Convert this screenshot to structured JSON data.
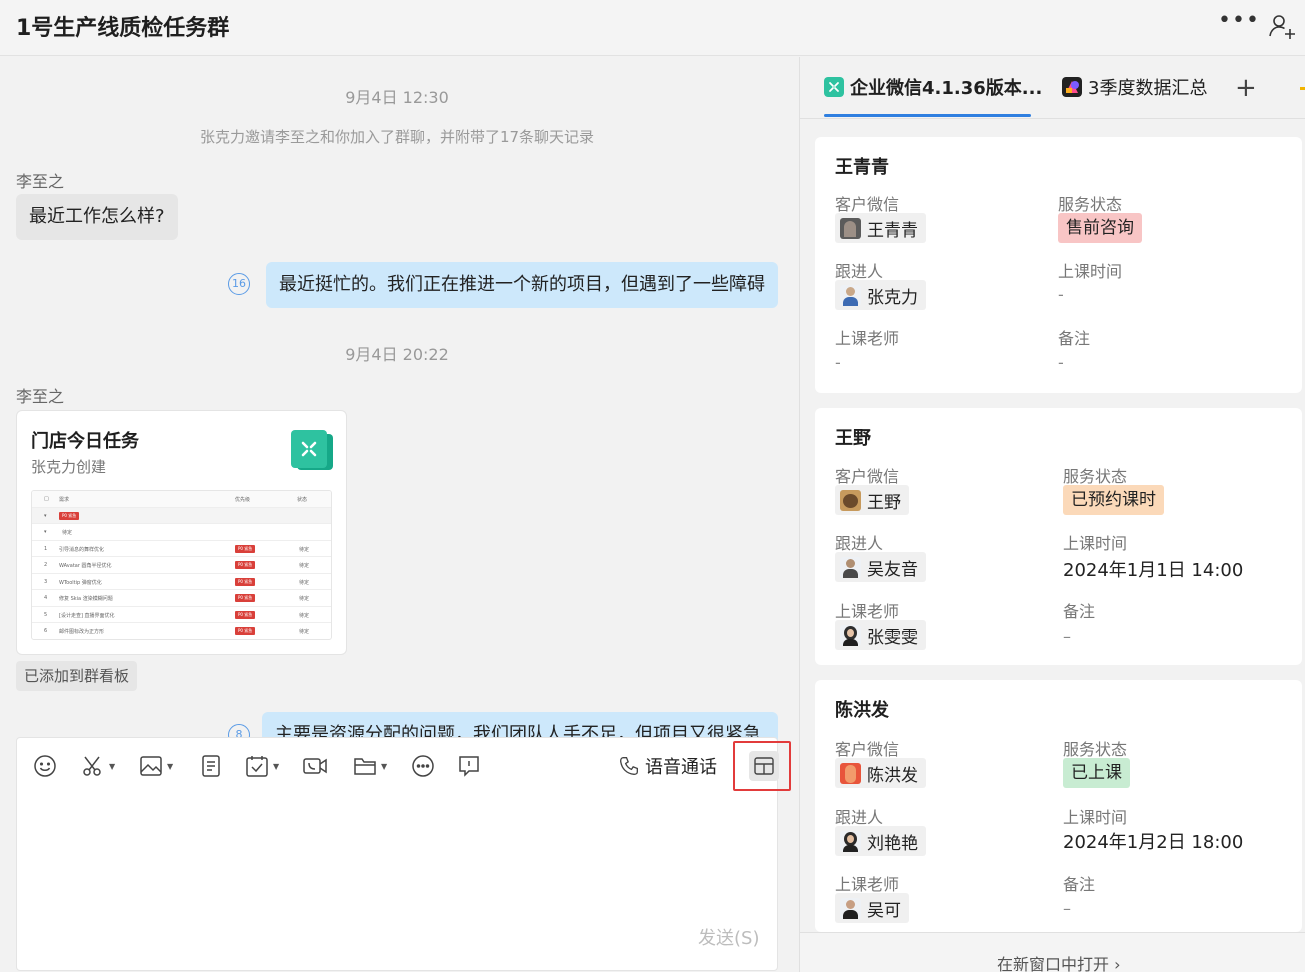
{
  "header": {
    "title": "1号生产线质检任务群"
  },
  "chat": {
    "ts1": "9月4日 12:30",
    "system_msg": "张克力邀请李至之和你加入了群聊，并附带了17条聊天记录",
    "msg1_sender": "李至之",
    "msg1_text": "最近工作怎么样?",
    "msg2_read": "16",
    "msg2_text": "最近挺忙的。我们正在推进一个新的项目，但遇到了一些障碍",
    "ts2": "9月4日 20:22",
    "msg3_sender": "李至之",
    "card": {
      "title": "门店今日任务",
      "creator": "张克力创建",
      "preview": {
        "headers": [
          "需求",
          "优先级",
          "状态"
        ],
        "group_tag": "P0 紧急",
        "group_label": "待定",
        "rows": [
          {
            "n": "1",
            "text": "引导消息的舞样优化",
            "tag": "P0 紧急",
            "status": "待定"
          },
          {
            "n": "2",
            "text": "WAvatar 圆角半径优化",
            "tag": "P0 紧急",
            "status": "待定"
          },
          {
            "n": "3",
            "text": "WTooltip 弹窗优化",
            "tag": "P0 紧急",
            "status": "待定"
          },
          {
            "n": "4",
            "text": "修复 Skia 渲染模糊问题",
            "tag": "P0 紧急",
            "status": "待定"
          },
          {
            "n": "5",
            "text": "[设计走查] 直播界面优化",
            "tag": "P0 紧急",
            "status": "待定"
          },
          {
            "n": "6",
            "text": "邮件图标改为正方形",
            "tag": "P0 紧急",
            "status": "待定"
          }
        ]
      }
    },
    "added_chip": "已添加到群看板",
    "msg4_text": "主要是资源分配的问题，我们团队人手不足，但项目又很紧急"
  },
  "composer": {
    "voice_label": "语音通话",
    "send_label": "发送(S)",
    "tools": [
      "emoji-icon",
      "scissors-icon",
      "image-icon",
      "document-icon",
      "calendar-check-icon",
      "video-icon",
      "folder-icon",
      "more-icon",
      "comment-icon"
    ]
  },
  "right": {
    "tabs": [
      {
        "label": "企业微信4.1.36版本...",
        "active": true
      },
      {
        "label": "3季度数据汇总",
        "active": false
      }
    ],
    "labels": {
      "wechat": "客户微信",
      "status": "服务状态",
      "follower": "跟进人",
      "class_time": "上课时间",
      "teacher": "上课老师",
      "note": "备注"
    },
    "customers": [
      {
        "name": "王青青",
        "wechat": "王青青",
        "status": "售前咨询",
        "status_color": "#f8c5c5",
        "follower": "张克力",
        "class_time": "-",
        "teacher": "-",
        "note": "-"
      },
      {
        "name": "王野",
        "wechat": "王野",
        "status": "已预约课时",
        "status_color": "#fbd9b9",
        "follower": "吴友音",
        "class_time": "2024年1月1日 14:00",
        "teacher": "张雯雯",
        "note": "–"
      },
      {
        "name": "陈洪发",
        "wechat": "陈洪发",
        "status": "已上课",
        "status_color": "#c8ecd2",
        "follower": "刘艳艳",
        "class_time": "2024年1月2日 18:00",
        "teacher": "吴可",
        "note": "–"
      }
    ],
    "open_window": "在新窗口中打开 ›"
  }
}
